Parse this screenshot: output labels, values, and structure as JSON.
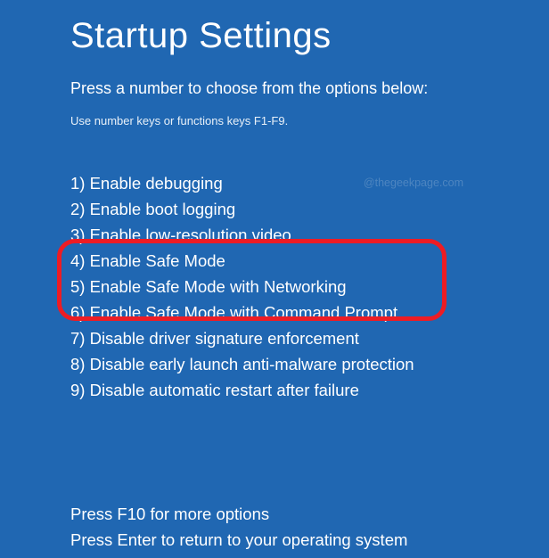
{
  "title": "Startup Settings",
  "subtitle": "Press a number to choose from the options below:",
  "hint": "Use number keys or functions keys F1-F9.",
  "options": [
    "1) Enable debugging",
    "2) Enable boot logging",
    "3) Enable low-resolution video",
    "4) Enable Safe Mode",
    "5) Enable Safe Mode with Networking",
    "6) Enable Safe Mode with Command Prompt",
    "7) Disable driver signature enforcement",
    "8) Disable early launch anti-malware protection",
    "9) Disable automatic restart after failure"
  ],
  "footer": {
    "more_options": "Press F10 for more options",
    "return_text": "Press Enter to return to your operating system"
  },
  "watermark": "@thegeekpage.com"
}
